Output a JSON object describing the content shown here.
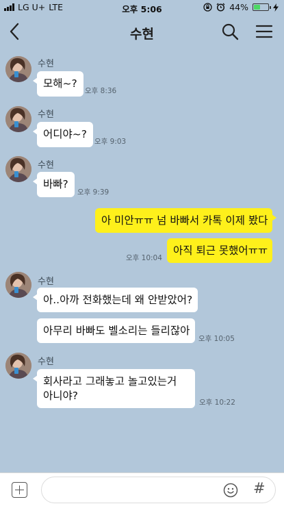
{
  "status_bar": {
    "carrier": "LG U+",
    "network": "LTE",
    "time": "오후 5:06",
    "battery_percent": "44%",
    "battery_level": 0.44
  },
  "header": {
    "title": "수현",
    "icons": [
      "back-arrow-icon",
      "search-icon",
      "hamburger-menu-icon"
    ]
  },
  "messages": [
    {
      "from": "수현",
      "text": "모해~?",
      "time": "오후 8:36"
    },
    {
      "from": "수현",
      "text": "어디야~?",
      "time": "오후 9:03"
    },
    {
      "from": "수현",
      "text": "바빠?",
      "time": "오후 9:39"
    },
    {
      "from": "me",
      "text": "아 미안ㅠㅠ 넘 바빠서 카톡 이제 봤다"
    },
    {
      "from": "me",
      "text": "아직 퇴근 못했어ㅠㅠ",
      "time": "오후 10:04"
    },
    {
      "from": "수현",
      "text": "아..아까 전화했는데 왜 안받았어?"
    },
    {
      "from": "수현",
      "text": "아무리 바빠도 벨소리는 들리잖아",
      "time": "오후 10:05"
    },
    {
      "from": "수현",
      "text_line1": "회사라고 그래놓고 놀고있는거",
      "text_line2": "아니야?",
      "time": "오후 10:22"
    }
  ],
  "input_bar": {
    "icons": [
      "plus-icon",
      "emoji-icon",
      "hash-icon"
    ],
    "hash_glyph": "#"
  },
  "colors": {
    "background": "#b2c7da",
    "my_bubble": "#fef01b",
    "their_bubble": "#ffffff"
  }
}
